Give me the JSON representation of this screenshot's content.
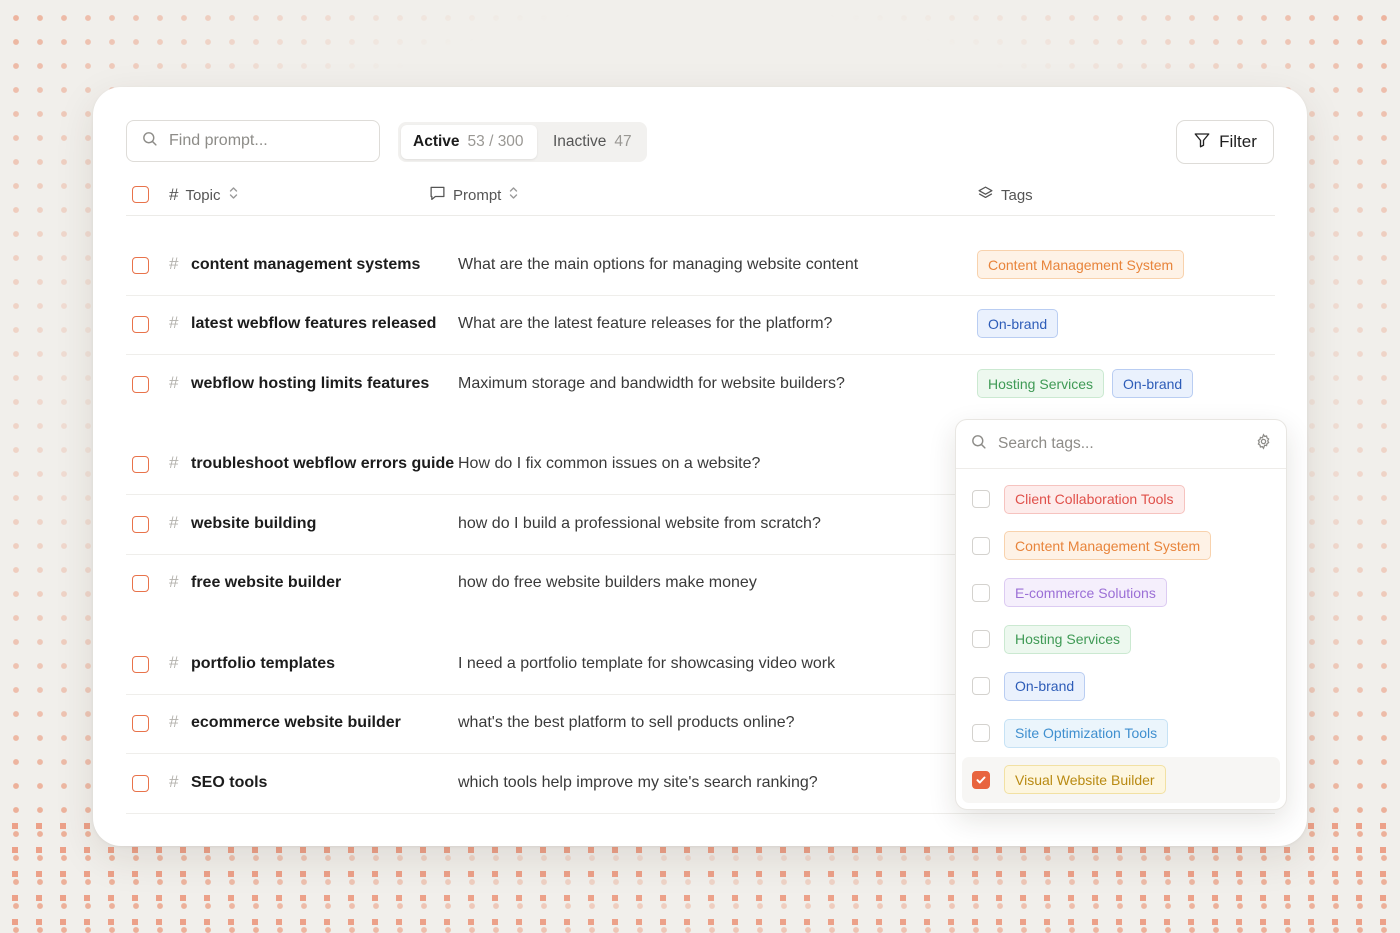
{
  "search": {
    "placeholder": "Find prompt..."
  },
  "segments": [
    {
      "label": "Active",
      "count": "53 / 300"
    },
    {
      "label": "Inactive",
      "count": "47"
    }
  ],
  "filter_label": "Filter",
  "columns": {
    "topic": "Topic",
    "prompt": "Prompt",
    "tags": "Tags"
  },
  "tag_styles": {
    "Client Collaboration Tools": {
      "bg": "#fdeceb",
      "border": "#f6c3bf",
      "color": "#e0504a"
    },
    "Content Management System": {
      "bg": "#fef2e6",
      "border": "#f8d2ad",
      "color": "#e8843b"
    },
    "E-commerce Solutions": {
      "bg": "#f5effc",
      "border": "#dccbf2",
      "color": "#9b6fd6"
    },
    "Hosting Services": {
      "bg": "#edf8ef",
      "border": "#cbe9d1",
      "color": "#3f9a55"
    },
    "On-brand": {
      "bg": "#eaf1fd",
      "border": "#b9cdf2",
      "color": "#2d5cb8"
    },
    "Site Optimization Tools": {
      "bg": "#ebf5fc",
      "border": "#c6e2f5",
      "color": "#3f8fcf"
    },
    "Visual Website Builder": {
      "bg": "#fdf6df",
      "border": "#f2e1a3",
      "color": "#b98a12"
    }
  },
  "rows": [
    {
      "topic": "content management systems",
      "prompt": "What are the main options for managing website content",
      "tags": [
        "Content Management System"
      ]
    },
    {
      "topic": "latest webflow features released",
      "prompt": "What are the latest feature releases for the platform?",
      "tags": [
        "On-brand"
      ]
    },
    {
      "topic": "webflow hosting limits features",
      "prompt": "Maximum storage and bandwidth for website builders?",
      "tags": [
        "Hosting Services",
        "On-brand"
      ]
    },
    {
      "topic": "troubleshoot webflow errors guide",
      "prompt": "How do I fix common issues on a website?",
      "tags": []
    },
    {
      "topic": "website building",
      "prompt": "how do I build a professional website from scratch?",
      "tags": []
    },
    {
      "topic": "free website builder",
      "prompt": "how do free website builders make money",
      "tags": []
    },
    {
      "topic": "portfolio templates",
      "prompt": "I need a portfolio template for showcasing video work",
      "tags": []
    },
    {
      "topic": "ecommerce website builder",
      "prompt": "what's the best platform to sell products online?",
      "tags": []
    },
    {
      "topic": "SEO tools",
      "prompt": "which tools help improve my site's search ranking?",
      "tags": []
    }
  ],
  "tag_dropdown": {
    "placeholder": "Search tags...",
    "options": [
      {
        "label": "Client Collaboration Tools",
        "checked": false
      },
      {
        "label": "Content Management System",
        "checked": false
      },
      {
        "label": "E-commerce Solutions",
        "checked": false
      },
      {
        "label": "Hosting Services",
        "checked": false
      },
      {
        "label": "On-brand",
        "checked": false
      },
      {
        "label": "Site Optimization Tools",
        "checked": false
      },
      {
        "label": "Visual Website Builder",
        "checked": true
      }
    ]
  },
  "accent_color": "#e8643e"
}
